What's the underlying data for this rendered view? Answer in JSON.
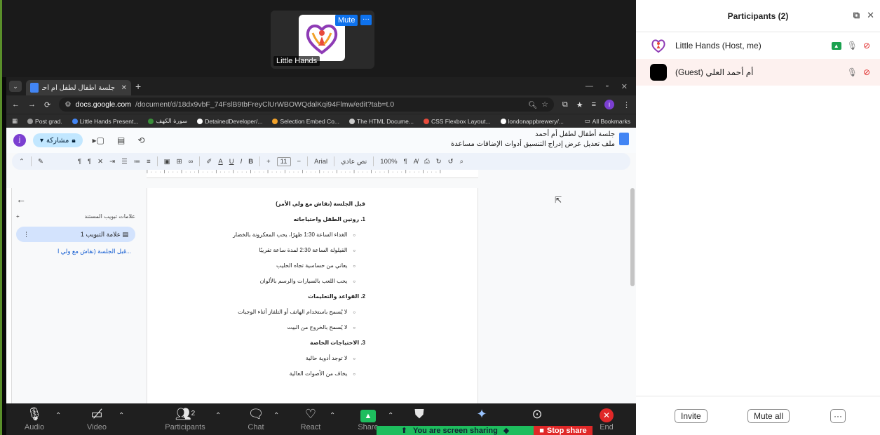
{
  "thumbnail": {
    "name": "Little Hands",
    "mute_label": "Mute",
    "more_label": "···"
  },
  "browser": {
    "tab_title": "جلسة أطفال لطفل أم أحمد - مستندات",
    "url_host": "docs.google.com",
    "url_path": "/document/d/18dx9vbF_74FslB9tbFreyClUrWBOWQdalKqi94Flmw/edit?tab=t.0",
    "bookmarks": [
      "Post grad.",
      "Little Hands Present...",
      "سورة الكهف",
      "DetainedDeveloper/...",
      "Selection Embed Co...",
      "The HTML Docume...",
      "CSS Flexbox Layout...",
      "londonappbrewery/..."
    ],
    "all_bookmarks": "All Bookmarks"
  },
  "docs": {
    "avatar_letter": "j",
    "share_label": "مشاركة",
    "title": "جلسة أطفال لطفل أم أحمد",
    "menus": "ملف  تعديل  عرض  إدراج  التنسيق  أدوات  الإضافات  مساعدة",
    "toolbar": {
      "zoom": "100%",
      "style": "نص عادي",
      "font": "Arial",
      "font_size": "11"
    },
    "outline": {
      "heading": "علامات تبويب المستند",
      "tab_name": "علامة التبويب 1",
      "section": "قبل الجلسة (نقاش مع ولي ا..."
    },
    "page_lines": [
      {
        "text": "قبل الجلسة (نقاش مع ولي الأمر)",
        "kind": "h"
      },
      {
        "text": "1.  روتين الطفل واحتياجاته",
        "kind": "h"
      },
      {
        "text": "الغداء الساعة 1:30 ظهرًا، يحب المعكرونة بالخضار",
        "kind": "li"
      },
      {
        "text": "القيلولة الساعة 2:30 لمدة ساعة تقريبًا",
        "kind": "li"
      },
      {
        "text": "يعاني من حساسية تجاه الحليب",
        "kind": "li"
      },
      {
        "text": "يحب اللعب بالسيارات والرسم بالألوان",
        "kind": "li"
      },
      {
        "text": "2.  القواعد والتعليمات",
        "kind": "h"
      },
      {
        "text": "لا يُسمح باستخدام الهاتف أو التلفاز أثناء الوجبات",
        "kind": "li"
      },
      {
        "text": "لا يُسمح بالخروج من البيت",
        "kind": "li"
      },
      {
        "text": "3.  الاحتياجات الخاصة",
        "kind": "h"
      },
      {
        "text": "لا توجد أدوية حالية",
        "kind": "li"
      },
      {
        "text": "يخاف من الأصوات العالية",
        "kind": "li"
      }
    ]
  },
  "zoom_toolbar": {
    "audio": "Audio",
    "video": "Video",
    "participants": "Participants",
    "participants_count": "2",
    "chat": "Chat",
    "react": "React",
    "share": "Share",
    "end": "End",
    "sharing_banner": "You are screen sharing",
    "stop_share": "Stop share"
  },
  "panel": {
    "title": "Participants (2)",
    "participants": [
      {
        "name": "Little Hands (Host, me)"
      },
      {
        "name": "(Guest) أم أحمد العلي"
      }
    ],
    "invite": "Invite",
    "mute_all": "Mute all",
    "more": "···"
  },
  "colors": {
    "zoom_blue": "#0e72ed",
    "share_green": "#1ebd5e",
    "end_red": "#e02828",
    "docs_blue": "#4285f4"
  }
}
